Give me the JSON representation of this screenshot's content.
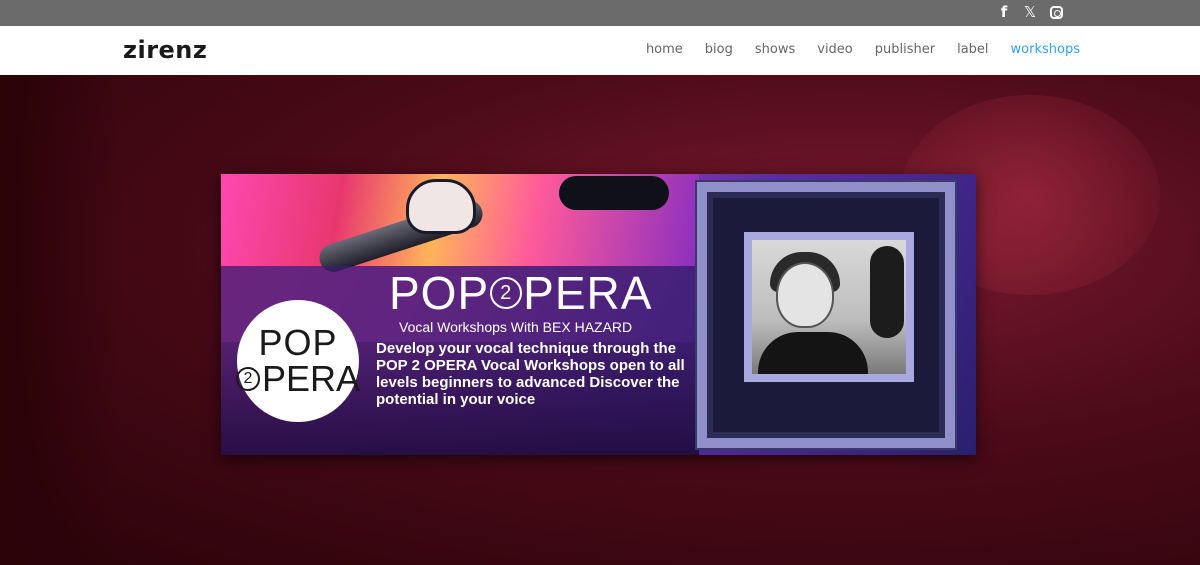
{
  "social": {
    "facebook_icon": "facebook-icon",
    "x_icon": "x-icon",
    "instagram_icon": "instagram-icon",
    "facebook_glyph": "f",
    "x_glyph": "𝕏"
  },
  "header": {
    "logo": "zirenz",
    "nav": [
      {
        "label": "home"
      },
      {
        "label": "biog"
      },
      {
        "label": "shows"
      },
      {
        "label": "video"
      },
      {
        "label": "publisher"
      },
      {
        "label": "label"
      },
      {
        "label": "workshops",
        "active": true
      }
    ],
    "active_color": "#2ea3f2"
  },
  "banner": {
    "circle_logo_line1": "POP",
    "circle_logo_num": "2",
    "circle_logo_line2": "PERA",
    "title_left": "POP",
    "title_num": "2",
    "title_right": "PERA",
    "subtitle": "Vocal Workshops With BEX HAZARD",
    "description": "Develop your vocal technique through the POP 2 OPERA Vocal Workshops open to all levels beginners to advanced Discover the potential in your voice"
  }
}
